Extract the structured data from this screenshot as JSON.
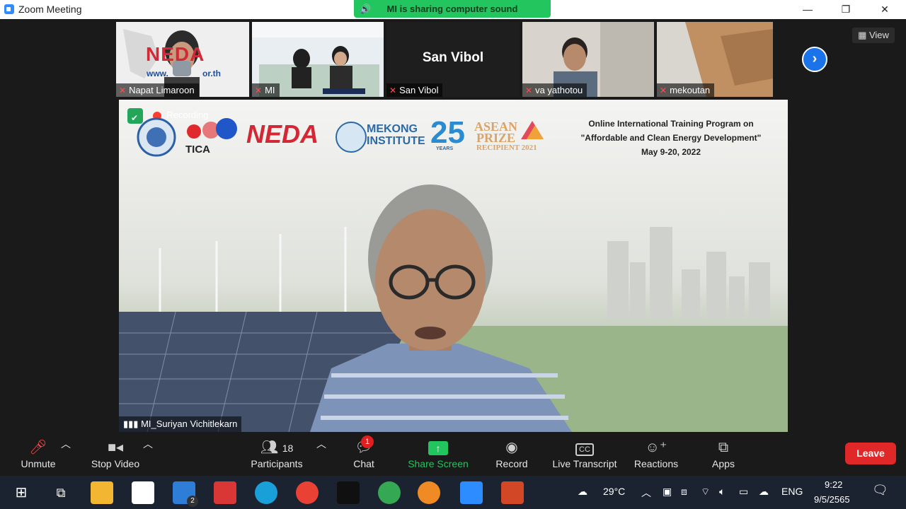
{
  "window": {
    "title": "Zoom Meeting",
    "minimize": "—",
    "maximize": "❐",
    "close": "✕"
  },
  "share_banner": {
    "text": "MI is sharing computer sound",
    "icon": "speaker-icon"
  },
  "view_button": {
    "label": "View",
    "icon": "grid-icon"
  },
  "participants_strip": [
    {
      "name": "Napat Limaroon",
      "muted": true,
      "bg": "#e9e9e9"
    },
    {
      "name": "MI",
      "muted": true,
      "bg": "#dfe6ef"
    },
    {
      "name": "San Vibol",
      "muted": true,
      "bg": "#1e1e1e",
      "center_name": "San Vibol"
    },
    {
      "name": "va yathotou",
      "muted": true,
      "bg": "#cfcbc4"
    },
    {
      "name": "mekoutan",
      "muted": true,
      "bg": "#b9946e"
    }
  ],
  "thumb_captions": {
    "napat_url_left": "www.",
    "napat_url_right": "or.th",
    "neda_logo": "NEDA"
  },
  "main_video": {
    "speaker": "MI_Suriyan Vichitlekarn",
    "recording": "Recording",
    "banner_line1": "Online International Training Program on",
    "banner_line2": "\"Affordable and Clean Energy Development\"",
    "banner_line3": "May 9-20, 2022",
    "logos": {
      "tica": "TICA",
      "neda": "NEDA",
      "mekong1": "MEKONG",
      "mekong2": "INSTITUTE",
      "years": "25",
      "years_sub": "YEARS",
      "asean": "ASEAN",
      "prize": "PRIZE",
      "recipient": "RECIPIENT 2021"
    }
  },
  "toolbar": {
    "unmute": "Unmute",
    "stop_video": "Stop Video",
    "participants": "Participants",
    "participants_count": "18",
    "chat": "Chat",
    "chat_badge": "1",
    "share_screen": "Share Screen",
    "record": "Record",
    "live_transcript": "Live Transcript",
    "reactions": "Reactions",
    "apps": "Apps",
    "leave": "Leave"
  },
  "taskbar": {
    "weather": "29°C",
    "lang": "ENG",
    "time": "9:22",
    "date": "9/5/2565",
    "mail_badge": "2"
  },
  "colors": {
    "accent": "#2d8cff",
    "share_green": "#22c55e",
    "leave_red": "#e02828"
  }
}
